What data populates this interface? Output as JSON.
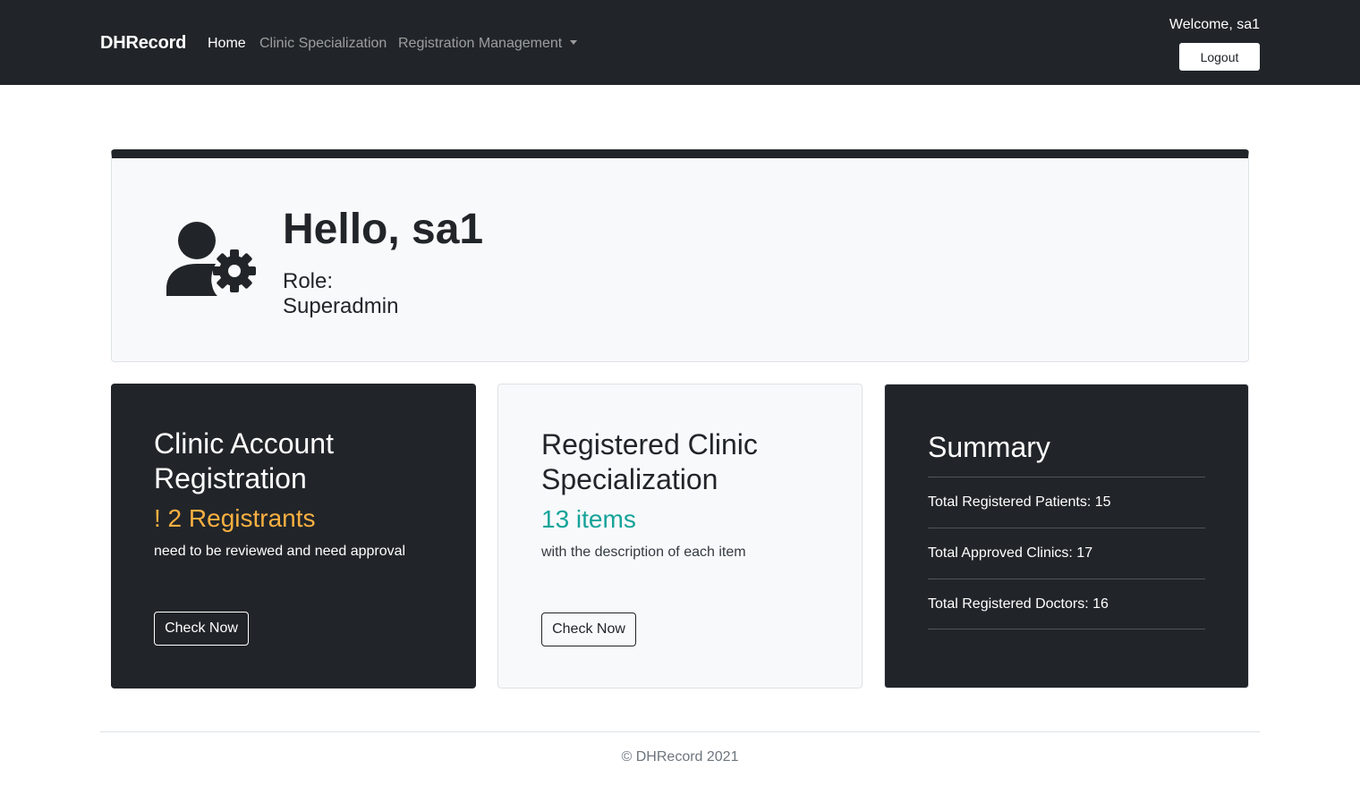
{
  "navbar": {
    "brand": "DHRecord",
    "links": [
      {
        "label": "Home",
        "active": true
      },
      {
        "label": "Clinic Specialization",
        "active": false
      },
      {
        "label": "Registration Management",
        "active": false,
        "dropdown": true
      }
    ],
    "welcome": "Welcome, sa1",
    "logout_label": "Logout"
  },
  "hero": {
    "icon": "user-gear-icon",
    "greeting": "Hello, sa1",
    "role_label": "Role:",
    "role": "Superadmin"
  },
  "cards": [
    {
      "title": "Clinic Account Registration",
      "highlight": "! 2 Registrants",
      "highlight_color": "#fbb041",
      "description": "need to be reviewed and need approval",
      "button_label": "Check Now"
    },
    {
      "title": "Registered Clinic Specialization",
      "highlight": "13 items",
      "highlight_color": "#16a39a",
      "description": "with the description of each item",
      "button_label": "Check Now"
    }
  ],
  "summary": {
    "title": "Summary",
    "items": [
      "Total Registered Patients: 15",
      "Total Approved Clinics: 17",
      "Total Registered Doctors: 16"
    ]
  },
  "footer": {
    "text": "© DHRecord 2021"
  },
  "colors": {
    "dark": "#212529",
    "light": "#f8f9fa",
    "accent_orange": "#fbb041",
    "accent_teal": "#16a39a"
  }
}
